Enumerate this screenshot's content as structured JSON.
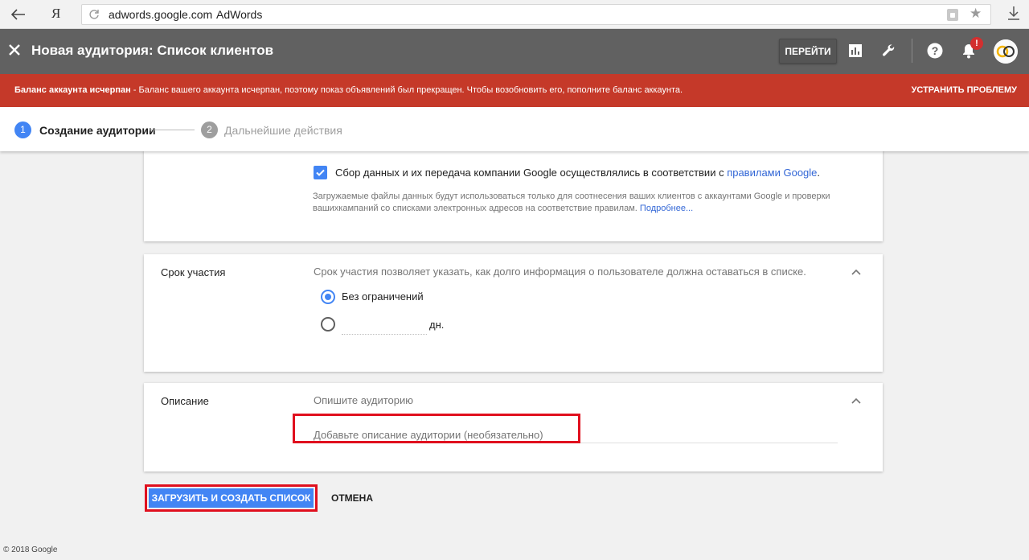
{
  "browser": {
    "yandex_label": "Я",
    "domain": "adwords.google.com",
    "page_title": "AdWords"
  },
  "header": {
    "title": "Новая аудитория: Список клиентов",
    "go_button": "ПЕРЕЙТИ",
    "notification_count": "!",
    "bg_color": "#616161"
  },
  "alert": {
    "title": "Баланс аккаунта исчерпан",
    "message": " - Баланс вашего аккаунта исчерпан, поэтому показ объявлений был прекращен. Чтобы возобновить его, пополните баланс аккаунта.",
    "action": "УСТРАНИТЬ ПРОБЛЕМУ",
    "bg_color": "#c53929"
  },
  "stepper": {
    "steps": [
      {
        "num": "1",
        "label": "Создание аудитории",
        "active": true
      },
      {
        "num": "2",
        "label": "Дальнейшие действия",
        "active": false
      }
    ]
  },
  "consent": {
    "checked": true,
    "text": "Сбор данных и их передача компании Google осуществлялись в соответствии с ",
    "link": "правилами Google",
    "text_end": ".",
    "info": "Загружаемые файлы данных будут использоваться только для соотнесения ваших клиентов с аккаунтами Google и проверки вашихкампаний со списками электронных адресов на соответствие правилам. ",
    "info_link": "Подробнее..."
  },
  "membership": {
    "label": "Срок участия",
    "description": "Срок участия позволяет указать, как долго информация о пользователе должна оставаться в списке.",
    "option_unlimited": "Без ограничений",
    "selected": "unlimited",
    "days_value": "",
    "days_unit": "дн."
  },
  "description": {
    "label": "Описание",
    "hint": "Опишите аудиторию",
    "placeholder": "Добавьте описание аудитории (необязательно)"
  },
  "actions": {
    "primary": "ЗАГРУЗИТЬ И СОЗДАТЬ СПИСОК",
    "cancel": "ОТМЕНА"
  },
  "footer": {
    "copyright": "© 2018 Google"
  },
  "colors": {
    "accent": "#4285f4",
    "highlight": "#e0101e",
    "link": "#3367d6"
  }
}
